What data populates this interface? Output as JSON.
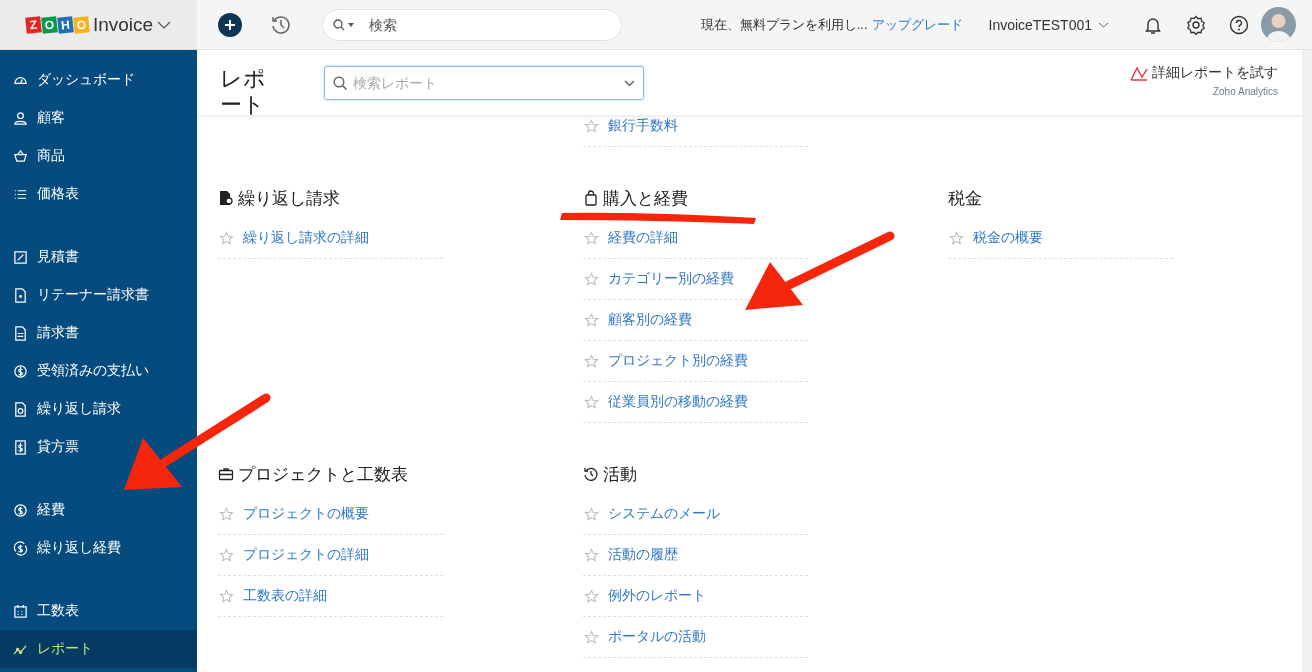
{
  "app": {
    "logo": [
      {
        "letter": "Z",
        "color": "#e42527"
      },
      {
        "letter": "O",
        "color": "#089949"
      },
      {
        "letter": "H",
        "color": "#226db4"
      },
      {
        "letter": "O",
        "color": "#f9b21d"
      }
    ],
    "name": "Invoice"
  },
  "header": {
    "search_placeholder": "検索",
    "plan_notice": "現在、無料プランを利用し...",
    "upgrade_link": "アップグレード",
    "org": "InvoiceTEST001"
  },
  "sidebar": {
    "groups": [
      {
        "items": [
          {
            "label": "ダッシュボード",
            "selected": false
          },
          {
            "label": "顧客",
            "selected": false
          },
          {
            "label": "商品",
            "selected": false
          },
          {
            "label": "価格表",
            "selected": false
          }
        ]
      },
      {
        "items": [
          {
            "label": "見積書",
            "selected": false
          },
          {
            "label": "リテーナー請求書",
            "selected": false
          },
          {
            "label": "請求書",
            "selected": false
          },
          {
            "label": "受領済みの支払い",
            "selected": false
          },
          {
            "label": "繰り返し請求",
            "selected": false
          },
          {
            "label": "貸方票",
            "selected": false
          }
        ]
      },
      {
        "items": [
          {
            "label": "経費",
            "selected": false
          },
          {
            "label": "繰り返し経費",
            "selected": false
          }
        ]
      },
      {
        "items": [
          {
            "label": "工数表",
            "selected": false
          },
          {
            "label": "レポート",
            "selected": true
          }
        ]
      }
    ]
  },
  "page": {
    "title": "レポート",
    "report_search_placeholder": "検索レポート",
    "analytics_link": "詳細レポートを試す",
    "analytics_caption": "Zoho Analytics"
  },
  "report_rows": [
    {
      "cells": [
        {
          "kind": "empty"
        },
        {
          "kind": "section",
          "items": [
            "銀行手数料"
          ]
        },
        {
          "kind": "empty"
        }
      ]
    },
    {
      "cells": [
        {
          "kind": "section",
          "heading": "繰り返し請求",
          "items": [
            "繰り返し請求の詳細"
          ]
        },
        {
          "kind": "section",
          "heading": "購入と経費",
          "items": [
            "経費の詳細",
            "カテゴリー別の経費",
            "顧客別の経費",
            "プロジェクト別の経費",
            "従業員別の移動の経費"
          ]
        },
        {
          "kind": "section",
          "heading": "税金",
          "items": [
            "税金の概要"
          ]
        }
      ]
    },
    {
      "cells": [
        {
          "kind": "section",
          "heading": "プロジェクトと工数表",
          "items": [
            "プロジェクトの概要",
            "プロジェクトの詳細",
            "工数表の詳細"
          ]
        },
        {
          "kind": "section",
          "heading": "活動",
          "items": [
            "システムのメール",
            "活動の履歴",
            "例外のレポート",
            "ポータルの活動"
          ]
        },
        {
          "kind": "empty"
        }
      ]
    }
  ],
  "annotations": [
    {
      "kind": "arrow"
    },
    {
      "kind": "underline"
    },
    {
      "kind": "arrow"
    }
  ]
}
